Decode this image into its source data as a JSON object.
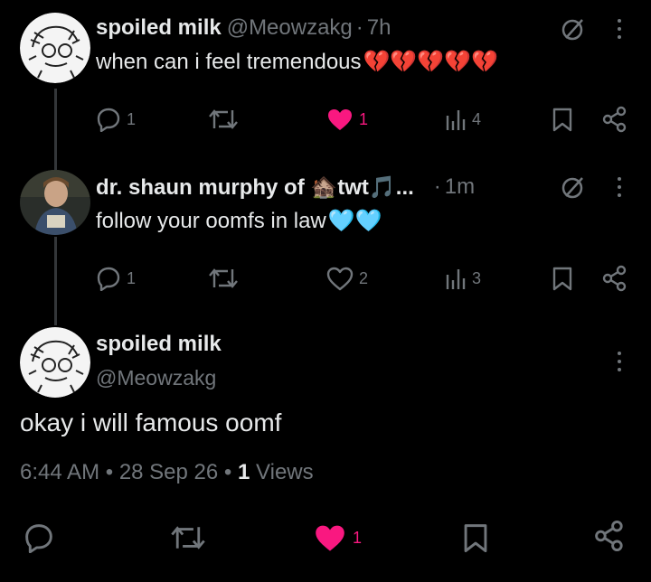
{
  "posts": [
    {
      "name": "spoiled milk",
      "handle": "@Meowzakg",
      "separator": "·",
      "time": "7h",
      "text": "when can i feel tremendous",
      "emojis": "💔💔💔💔💔",
      "replies": "1",
      "likes": "1",
      "liked": true,
      "views": "4"
    },
    {
      "name": "dr. shaun murphy of 🏚️twt🎵...",
      "handle": "",
      "separator": "·",
      "time": "1m",
      "text": "follow your oomfs in law",
      "emojis": "🩵🩵",
      "replies": "1",
      "likes": "2",
      "liked": false,
      "views": "3"
    }
  ],
  "main_post": {
    "name": "spoiled milk",
    "handle": "@Meowzakg",
    "text": "okay i will famous oomf",
    "time": "6:44 AM",
    "date": "28 Sep 26",
    "bullet": "•",
    "views_count": "1",
    "views_label": "Views",
    "likes": "1",
    "liked": true
  },
  "colors": {
    "background": "#000000",
    "text": "#e7e9ea",
    "muted": "#71767b",
    "like": "#f91880",
    "thread_line": "#333639"
  },
  "icons": [
    "reply-icon",
    "repost-icon",
    "heart-icon",
    "views-icon",
    "bookmark-icon",
    "share-icon",
    "grok-icon",
    "more-icon"
  ]
}
